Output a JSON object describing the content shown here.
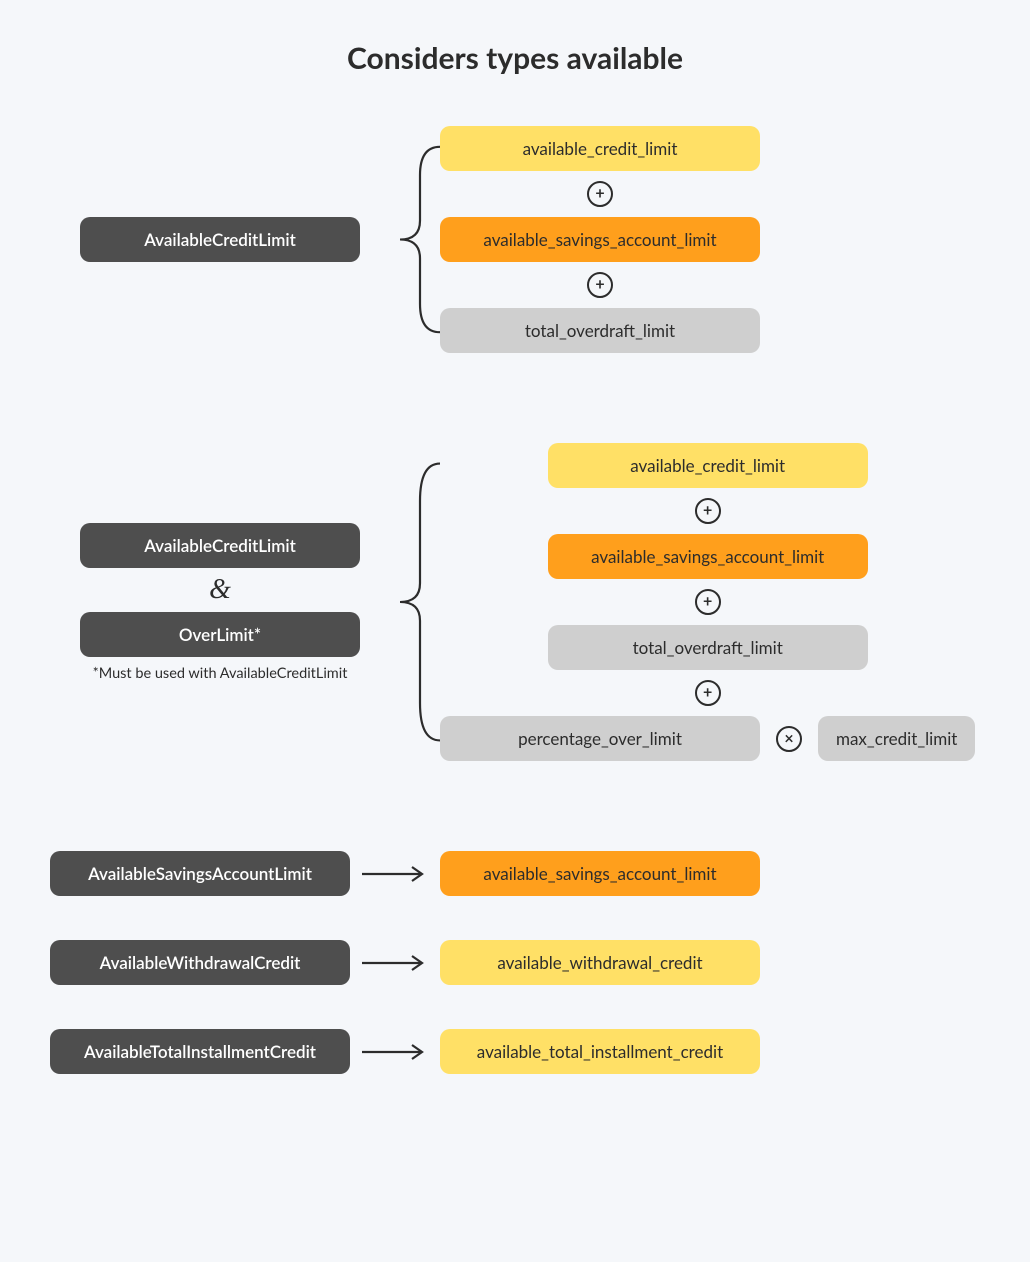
{
  "title": "Considers types available",
  "section1": {
    "source": "AvailableCreditLimit",
    "terms": [
      "available_credit_limit",
      "available_savings_account_limit",
      "total_overdraft_limit"
    ],
    "ops": [
      "+",
      "+"
    ]
  },
  "section2": {
    "source_a": "AvailableCreditLimit",
    "amp": "&",
    "source_b": "OverLimit*",
    "footnote": "*Must be used with AvailableCreditLimit",
    "terms": [
      "available_credit_limit",
      "available_savings_account_limit",
      "total_overdraft_limit"
    ],
    "ops": [
      "+",
      "+",
      "+"
    ],
    "last_term": "percentage_over_limit",
    "last_op": "×",
    "last_factor": "max_credit_limit"
  },
  "simple": [
    {
      "source": "AvailableSavingsAccountLimit",
      "target": "available_savings_account_limit",
      "color": "orange"
    },
    {
      "source": "AvailableWithdrawalCredit",
      "target": "available_withdrawal_credit",
      "color": "yellow"
    },
    {
      "source": "AvailableTotalInstallmentCredit",
      "target": "available_total_installment_credit",
      "color": "yellow"
    }
  ],
  "ops_glyph": {
    "plus": "+",
    "times": "×"
  }
}
